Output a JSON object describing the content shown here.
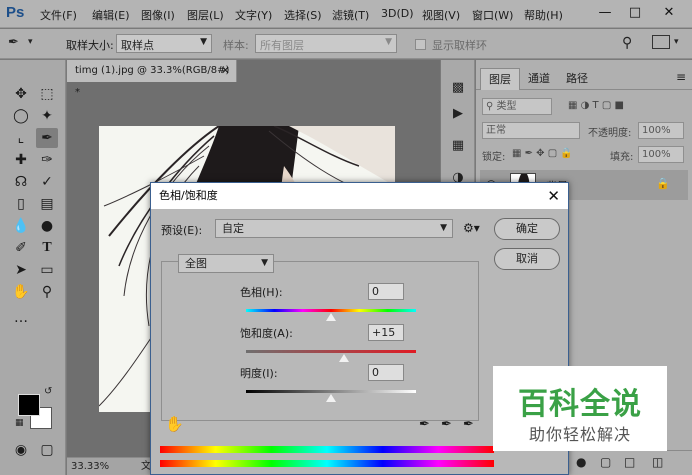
{
  "app": {
    "logo": "Ps"
  },
  "menu": [
    "文件(F)",
    "编辑(E)",
    "图像(I)",
    "图层(L)",
    "文字(Y)",
    "选择(S)",
    "滤镜(T)",
    "3D(D)",
    "视图(V)",
    "窗口(W)",
    "帮助(H)"
  ],
  "options": {
    "sample_size_label": "取样大小:",
    "sample_size_value": "取样点",
    "sample_label": "样本:",
    "sample_value": "所有图层",
    "show_ring_label": "显示取样环"
  },
  "document": {
    "tab_title": "timg (1).jpg @ 33.3%(RGB/8#) *",
    "zoom": "33.33%",
    "status_suffix": "文"
  },
  "layers_panel": {
    "tabs": [
      "图层",
      "通道",
      "路径"
    ],
    "kind_label": "类型",
    "blend_mode": "正常",
    "opacity_label": "不透明度:",
    "opacity_value": "100%",
    "lock_label": "锁定:",
    "fill_label": "填充:",
    "fill_value": "100%",
    "layer_name": "背景"
  },
  "dialog": {
    "title": "色相/饱和度",
    "preset_label": "预设(E):",
    "preset_value": "自定",
    "ok_label": "确定",
    "cancel_label": "取消",
    "channel_value": "全图",
    "hue_label": "色相(H):",
    "hue_value": "0",
    "hue_level": 0,
    "saturation_label": "饱和度(A):",
    "saturation_value": "+15",
    "saturation_level": 15,
    "lightness_label": "明度(I):",
    "lightness_value": "0",
    "lightness_level": 0
  },
  "watermark": {
    "title": "百科全说",
    "subtitle": "助你轻松解决"
  },
  "colors": {
    "watermark_green": "#3aa146",
    "dialog_border": "#3a5f8f"
  }
}
